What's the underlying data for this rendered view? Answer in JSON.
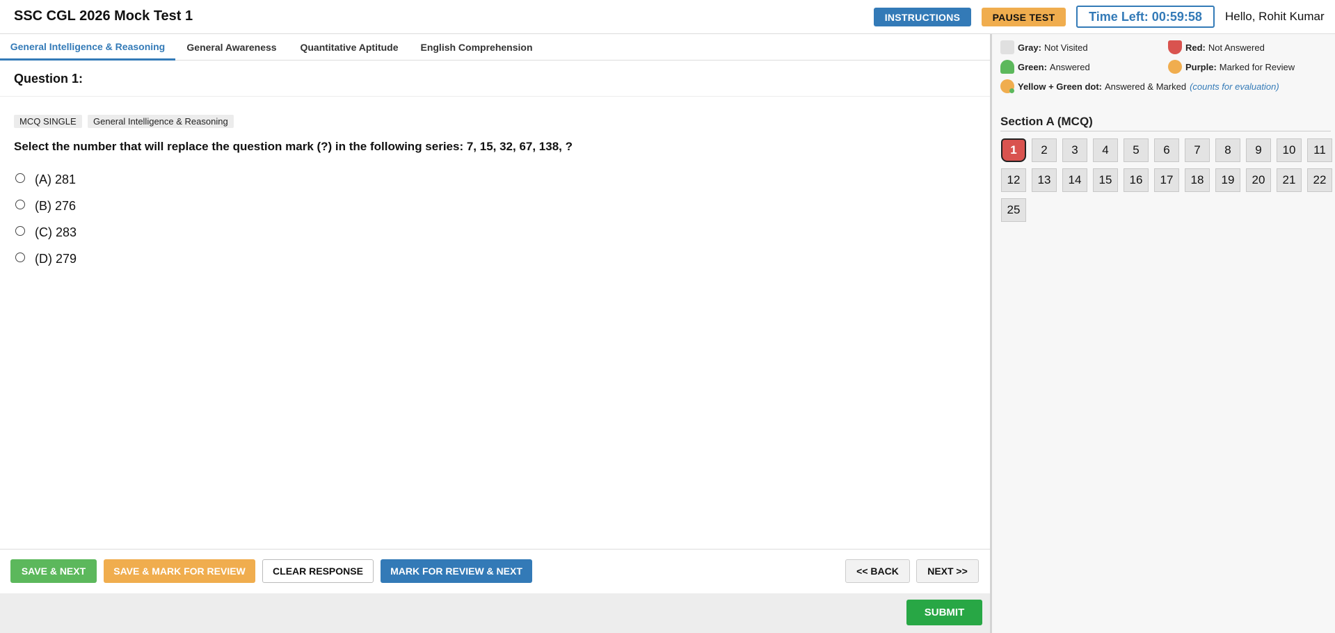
{
  "header": {
    "title": "SSC CGL 2026 Mock Test 1",
    "instructions_label": "INSTRUCTIONS",
    "pause_label": "PAUSE TEST",
    "timer_label": "Time Left: 00:59:58",
    "greeting": "Hello, Rohit Kumar"
  },
  "tabs": [
    {
      "label": "General Intelligence & Reasoning",
      "active": true
    },
    {
      "label": "General Awareness",
      "active": false
    },
    {
      "label": "Quantitative Aptitude",
      "active": false
    },
    {
      "label": "English Comprehension",
      "active": false
    }
  ],
  "question": {
    "heading": "Question 1:",
    "type_badge": "MCQ SINGLE",
    "section_badge": "General Intelligence & Reasoning",
    "text": "Select the number that will replace the question mark (?) in the following series: 7, 15, 32, 67, 138, ?",
    "options": [
      "(A) 281",
      "(B) 276",
      "(C) 283",
      "(D) 279"
    ]
  },
  "actions": {
    "save_next": "SAVE & NEXT",
    "save_mark": "SAVE & MARK FOR REVIEW",
    "clear": "CLEAR RESPONSE",
    "mark_next": "MARK FOR REVIEW & NEXT",
    "back": "<< BACK",
    "next": "NEXT >>",
    "submit": "SUBMIT"
  },
  "legend": {
    "gray_key": "Gray:",
    "gray_text": "Not Visited",
    "red_key": "Red:",
    "red_text": "Not Answered",
    "green_key": "Green:",
    "green_text": "Answered",
    "purple_key": "Purple:",
    "purple_text": "Marked for Review",
    "yellow_key": "Yellow + Green dot:",
    "yellow_text": "Answered & Marked",
    "yellow_note": "(counts for evaluation)"
  },
  "palette": {
    "section_title": "Section A (MCQ)",
    "questions": [
      "1",
      "2",
      "3",
      "4",
      "5",
      "6",
      "7",
      "8",
      "9",
      "10",
      "11",
      "12",
      "13",
      "14",
      "15",
      "16",
      "17",
      "18",
      "19",
      "20",
      "21",
      "22",
      "25"
    ],
    "current": "1"
  },
  "colors": {
    "primary": "#337ab7",
    "warning": "#f0ad4e",
    "success": "#5cb85c",
    "danger": "#d9534f",
    "submit": "#28a745"
  }
}
